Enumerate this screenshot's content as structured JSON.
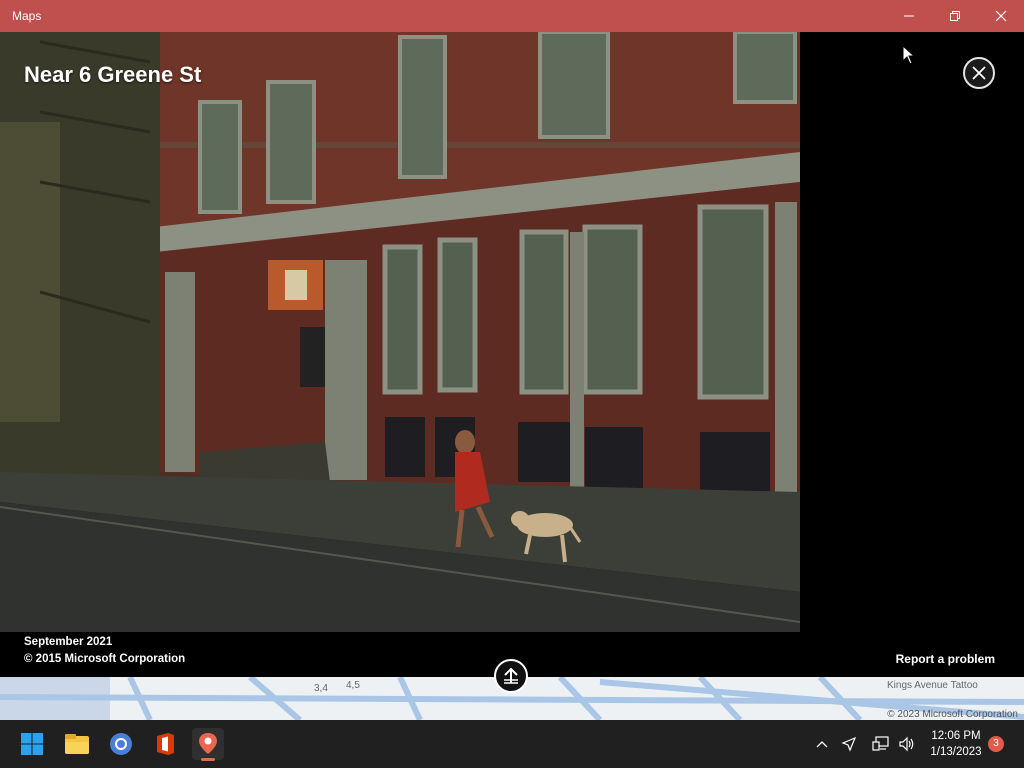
{
  "window": {
    "title": "Maps",
    "titlebar_color": "#c0504d",
    "controls": [
      "minimize-icon",
      "restore-icon",
      "close-icon"
    ]
  },
  "streetside": {
    "title": "Near 6 Greene St",
    "capture_date": "September 2021",
    "copyright": "© 2015 Microsoft Corporation",
    "report_label": "Report a problem"
  },
  "map": {
    "copyright": "© 2023 Microsoft Corporation",
    "labels": [
      "3,4",
      "4,5",
      "Kings Avenue Tattoo"
    ]
  },
  "taskbar": {
    "apps": [
      "windows-start-icon",
      "file-explorer-icon",
      "chrome-icon",
      "office-icon",
      "maps-icon"
    ],
    "active_app": "maps-icon",
    "clock": {
      "time": "12:06 PM",
      "date": "1/13/2023"
    },
    "notification_count": "3"
  }
}
